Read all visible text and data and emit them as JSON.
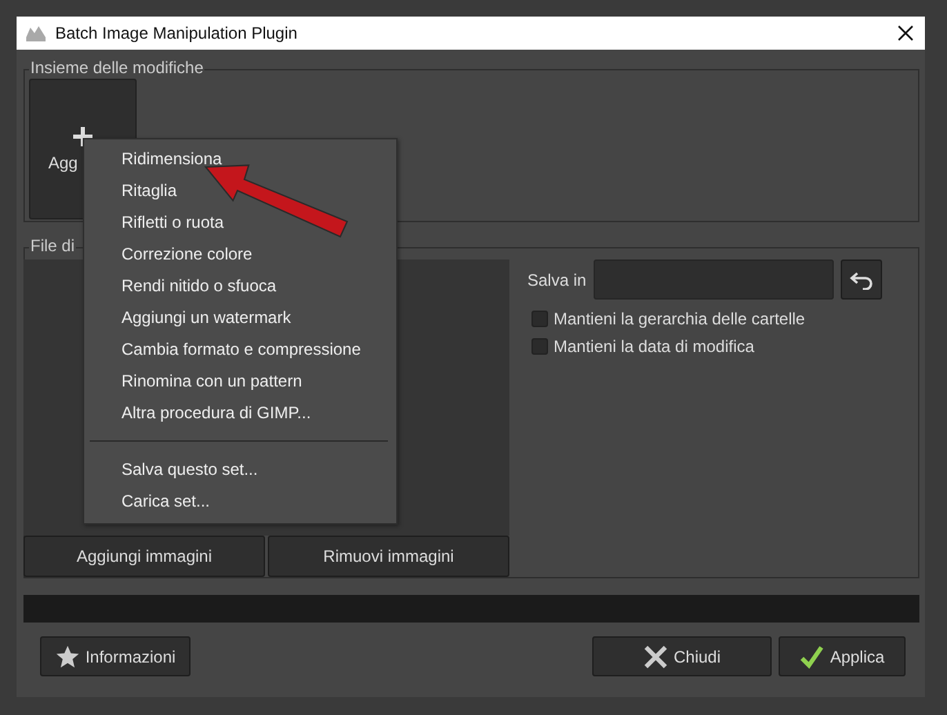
{
  "window": {
    "title": "Batch Image Manipulation Plugin"
  },
  "changes": {
    "legend": "Insieme delle modifiche",
    "add_tile": {
      "label": "Agg"
    }
  },
  "menu": {
    "items": [
      {
        "label": "Ridimensiona",
        "kind": "item"
      },
      {
        "label": "Ritaglia",
        "kind": "item"
      },
      {
        "label": "Rifletti o ruota",
        "kind": "item"
      },
      {
        "label": "Correzione colore",
        "kind": "item"
      },
      {
        "label": "Rendi nitido o sfuoca",
        "kind": "item"
      },
      {
        "label": "Aggiungi un watermark",
        "kind": "item"
      },
      {
        "label": "Cambia formato e compressione",
        "kind": "item"
      },
      {
        "label": "Rinomina con un pattern",
        "kind": "item"
      },
      {
        "label": "Altra procedura di GIMP...",
        "kind": "item"
      },
      {
        "kind": "separator"
      },
      {
        "label": "Salva questo set...",
        "kind": "item"
      },
      {
        "label": "Carica set..."
      }
    ]
  },
  "files": {
    "legend": "File di",
    "buttons": [
      "Aggiungi immagini",
      "Rimuovi immagini"
    ]
  },
  "output": {
    "label": "Salva in",
    "options": [
      {
        "label": "Mantieni la gerarchia delle cartelle",
        "checked": false
      },
      {
        "label": "Mantieni la data di modifica",
        "checked": false
      }
    ]
  },
  "progress": {
    "level": 0
  },
  "buttons": {
    "info": "Informazioni",
    "close": "Chiudi",
    "apply": "Applica"
  }
}
